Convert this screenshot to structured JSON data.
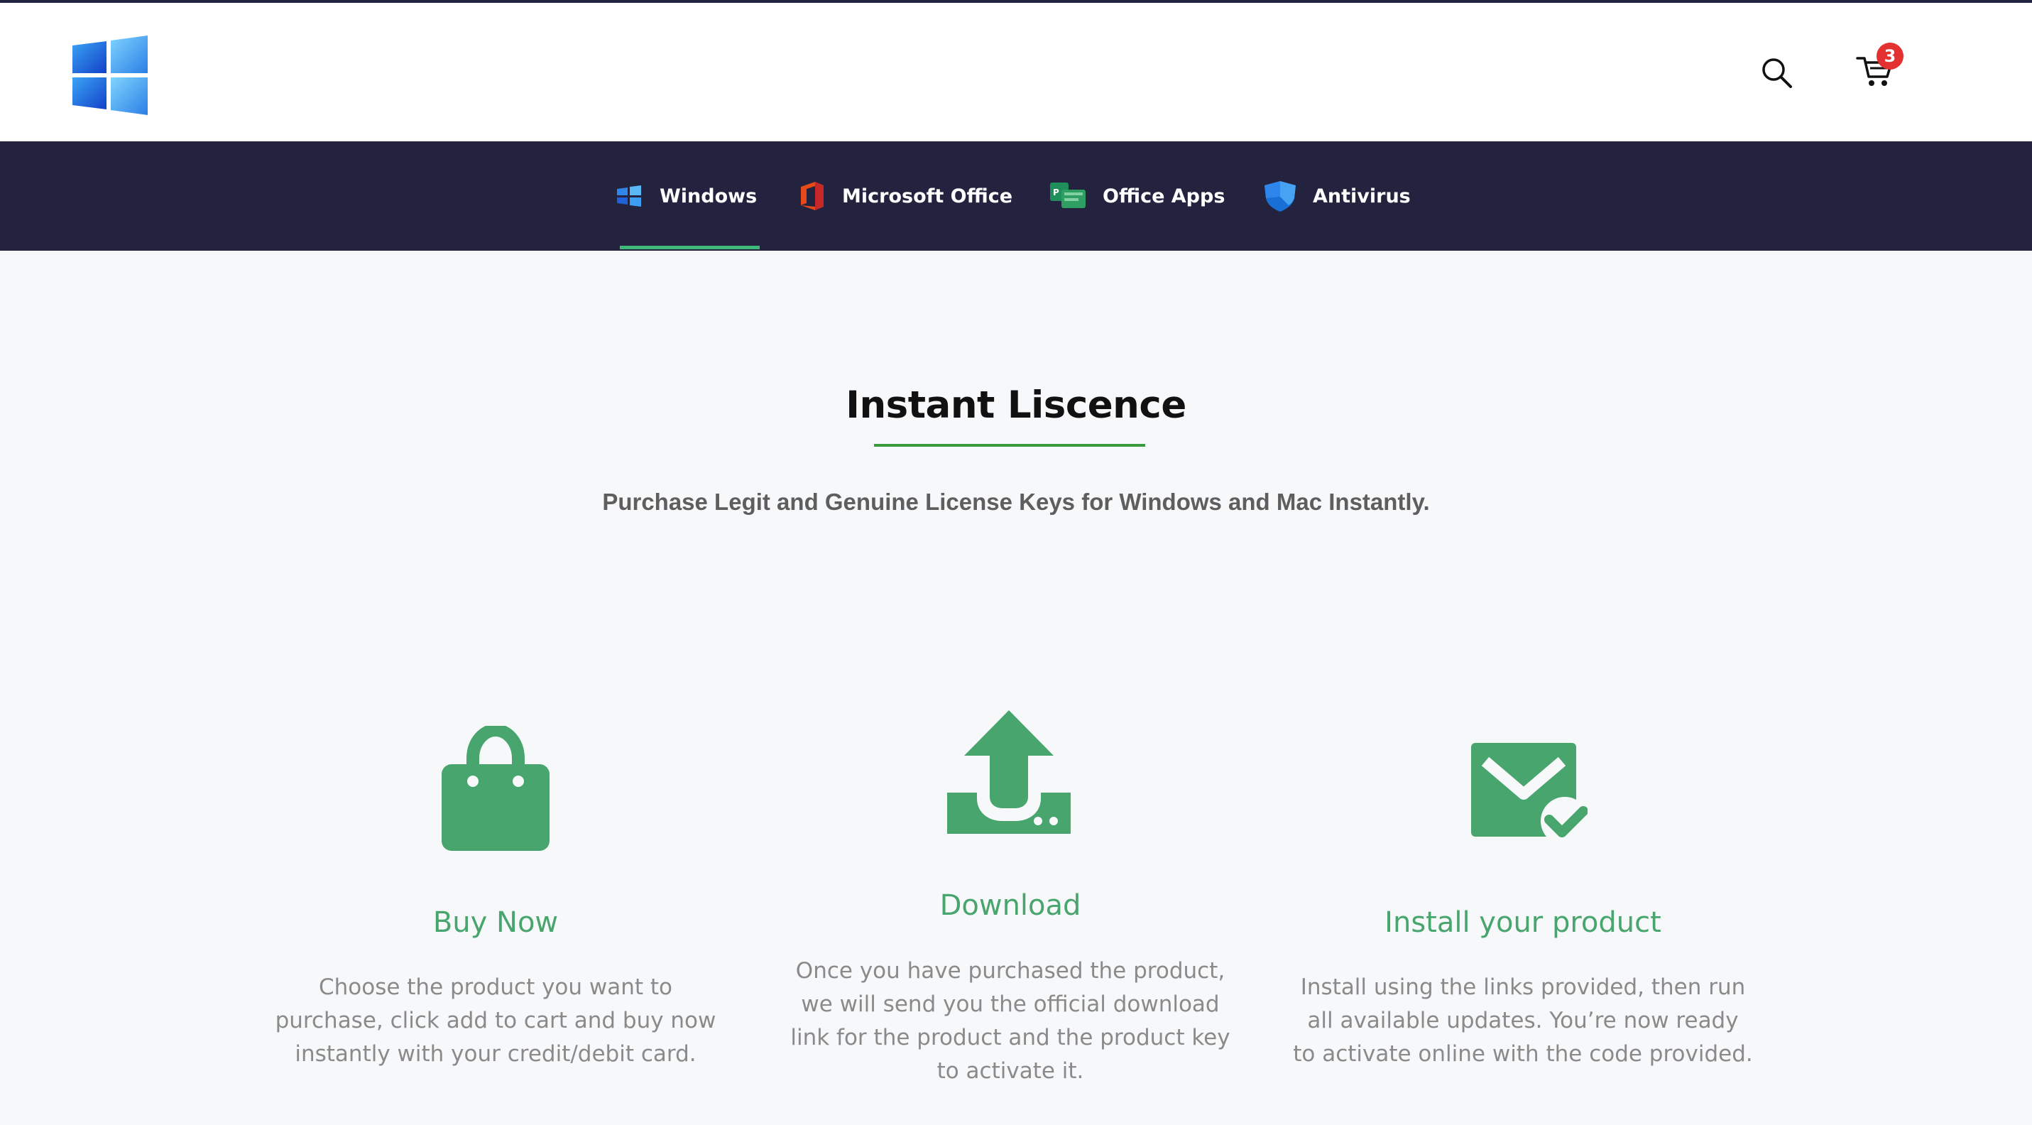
{
  "header": {
    "logo_name": "windows-logo",
    "cart_count": "3"
  },
  "nav": {
    "items": [
      {
        "label": "Windows",
        "icon": "windows-icon"
      },
      {
        "label": "Microsoft Office",
        "icon": "office-icon"
      },
      {
        "label": "Office Apps",
        "icon": "office-apps-icon"
      },
      {
        "label": "Antivirus",
        "icon": "shield-icon"
      }
    ],
    "active_index": 0
  },
  "main": {
    "title": "Instant Liscence",
    "subtitle": "Purchase Legit and Genuine License Keys for Windows and Mac Instantly."
  },
  "steps": [
    {
      "icon": "shopping-bag-icon",
      "title": "Buy Now",
      "lines": [
        "Choose the product you want to",
        "purchase, click add to cart and buy now",
        "instantly with your credit/debit card."
      ]
    },
    {
      "icon": "upload-icon",
      "title": "Download",
      "lines": [
        "Once you have purchased the product,",
        "we will send you the official download",
        "link for the product and the product key",
        "to activate it."
      ]
    },
    {
      "icon": "mail-check-icon",
      "title": "Install your product",
      "lines": [
        "Install using the links provided, then run",
        "all available updates. You’re now ready",
        "to activate online with the code provided."
      ]
    }
  ],
  "colors": {
    "nav_bg": "#24233f",
    "accent_green": "#48a56d",
    "underline_green": "#3fb87a",
    "badge_red": "#e33030"
  }
}
